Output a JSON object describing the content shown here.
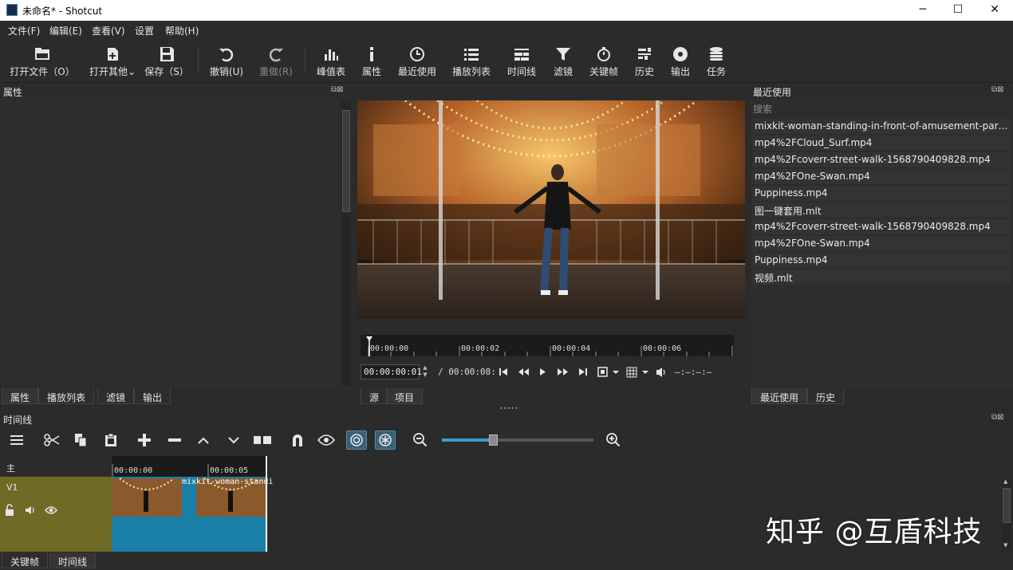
{
  "window": {
    "title": "未命名* - Shotcut",
    "minimize": "─",
    "maximize": "☐",
    "close": "✕"
  },
  "menu": [
    "文件(F)",
    "编辑(E)",
    "查看(V)",
    "设置",
    "帮助(H)"
  ],
  "toolbar": {
    "open_file": "打开文件（O）",
    "open_other": "打开其他",
    "save": "保存（S）",
    "undo": "撤销(U)",
    "redo": "重做(R)",
    "peak_meter": "峰值表",
    "properties": "属性",
    "recent": "最近使用",
    "playlist": "播放列表",
    "timeline": "时间线",
    "filters": "滤镜",
    "keyframes": "关键帧",
    "history": "历史",
    "export": "输出",
    "jobs": "任务"
  },
  "properties_panel": {
    "title": "属性",
    "tabs": [
      "属性",
      "播放列表",
      "滤镜",
      "输出"
    ]
  },
  "player": {
    "ruler_labels": [
      "00:00:00",
      "00:00:02",
      "00:00:04",
      "00:00:06"
    ],
    "current_timecode": "00:00:00:01",
    "duration": "/ 00:00:08:",
    "inout": "—:—:—:—",
    "tabs": [
      "源",
      "项目"
    ]
  },
  "recent_panel": {
    "title": "最近使用",
    "search_placeholder": "搜索",
    "items": [
      "mixkit-woman-standing-in-front-of-amusement-park...",
      "mp4%2FCloud_Surf.mp4",
      "mp4%2Fcoverr-street-walk-1568790409828.mp4",
      "mp4%2FOne-Swan.mp4",
      "Puppiness.mp4",
      "图一键套用.mlt",
      "mp4%2Fcoverr-street-walk-1568790409828.mp4",
      "mp4%2FOne-Swan.mp4",
      "Puppiness.mp4",
      "视频.mlt"
    ],
    "tabs": [
      "最近使用",
      "历史"
    ]
  },
  "timeline": {
    "title": "时间线",
    "master_label": "主",
    "track_label": "V1",
    "ruler_labels": [
      "00:00:00",
      "00:00:05"
    ],
    "clip_label": "mixkit-woman-standi",
    "bottom_tabs": [
      "关键帧",
      "时间线"
    ]
  },
  "watermark": "知乎 @互盾科技",
  "colors": {
    "track_head": "#6f6a26",
    "clip": "#1a7fa8",
    "accent": "#3d9bd1"
  }
}
